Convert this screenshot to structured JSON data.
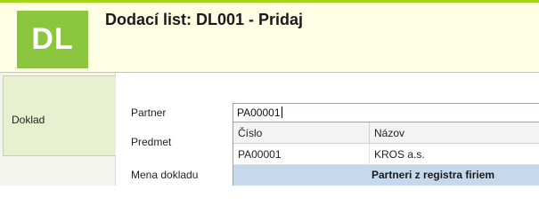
{
  "header": {
    "logo_text": "DL",
    "title": "Dodací list: DL001 - Pridaj"
  },
  "sidebar": {
    "items": [
      {
        "label": "Doklad"
      }
    ]
  },
  "form": {
    "partner_label": "Partner",
    "partner_value": "PA00001",
    "predmet_label": "Predmet",
    "mena_label": "Mena dokladu"
  },
  "dropdown": {
    "columns": [
      "Číslo",
      "Názov"
    ],
    "rows": [
      {
        "cislo": "PA00001",
        "nazov": "KROS a.s."
      }
    ],
    "footer": "Partneri z registra firiem"
  },
  "colors": {
    "accent": "#8cc63f",
    "header_bg": "#ffffe6",
    "selection_bg": "#c6d9ec"
  }
}
